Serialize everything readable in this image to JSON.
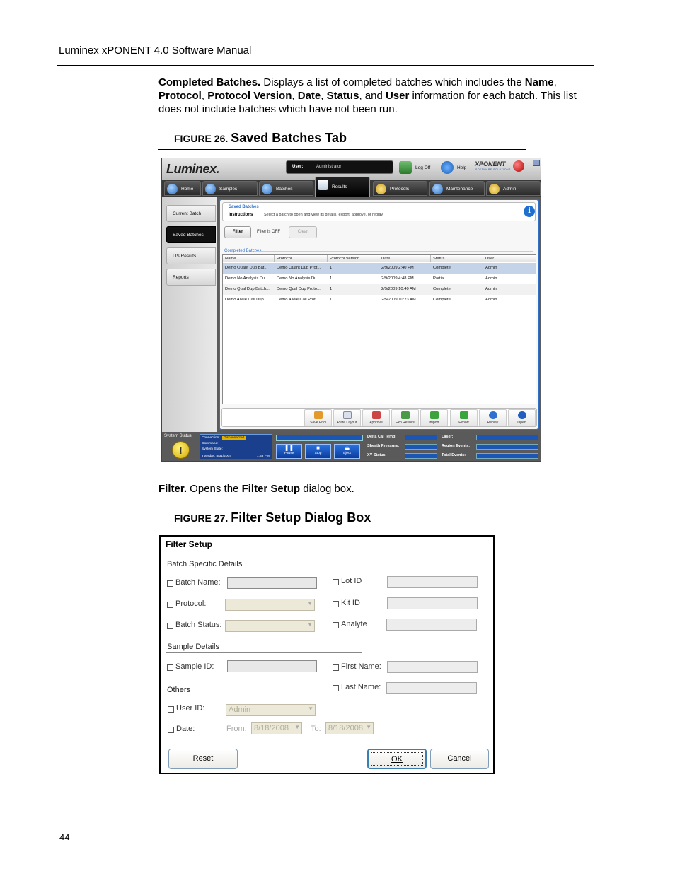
{
  "header": {
    "title": "Luminex xPONENT 4.0 Software Manual"
  },
  "para1": {
    "b1": "Completed Batches.",
    "t1": " Displays a list of completed batches which includes the ",
    "b2": "Name",
    "t2": ",",
    "b3": "Protocol",
    "t3": ", ",
    "b4": "Protocol Version",
    "t4": ", ",
    "b5": "Date",
    "t5": ", ",
    "b6": "Status",
    "t6": ", and ",
    "b7": "User",
    "t7": " information for each batch. This list",
    "line3": "does not include batches which have not been run."
  },
  "fig26": {
    "label": "FIGURE 26.",
    "title": "Saved Batches Tab"
  },
  "app": {
    "logo": "Luminex.",
    "user_label": "User:",
    "user_value": "Administrator",
    "logoff": "Log Off",
    "help": "Help",
    "brand": "XPONENT",
    "brand_sub": "SOFTWARE SOLUTIONS",
    "tabs": [
      "Home",
      "Samples",
      "Batches",
      "Results",
      "Protocols",
      "Maintenance",
      "Admin"
    ],
    "side": [
      "Current Batch",
      "Saved Batches",
      "LIS Results",
      "Reports"
    ],
    "instr_title": "Saved Batches",
    "instr_label": "Instructions",
    "instr_text": "Select a batch to open and view its details, export, approve, or replay.",
    "filter_btn": "Filter",
    "filter_status": "Filter is OFF",
    "clear_btn": "Clear",
    "completed_label": "Completed Batches",
    "columns": [
      "Name",
      "Protocol",
      "Protocol Version",
      "Date",
      "Status",
      "User"
    ],
    "rows": [
      [
        "Demo Quant Dup Bat...",
        "Demo Quant Dup Prot...",
        "1",
        "2/9/2009 2:40 PM",
        "Complete",
        "Admin"
      ],
      [
        "Demo No Analysis Du...",
        "Demo No Analysis Du...",
        "1",
        "2/9/2009 4:48 PM",
        "Partial",
        "Admin"
      ],
      [
        "Demo Qual Dup Batch...",
        "Demo Qual Dup Proto...",
        "1",
        "2/5/2009 10:40 AM",
        "Complete",
        "Admin"
      ],
      [
        "Demo Allele Call Dup ...",
        "Demo Allele Call Prot...",
        "1",
        "2/5/2009 10:23 AM",
        "Complete",
        "Admin"
      ]
    ],
    "toolbar": [
      "Save Prtcl",
      "Plate Layout",
      "Approve",
      "Exp Results",
      "Import",
      "Export",
      "Replay",
      "Open"
    ],
    "status": {
      "system_status": "System Status",
      "connection_label": "Connection:",
      "connection_value": "Disconnected",
      "command_label": "Command:",
      "state_label": "System State:",
      "date": "Tuesday, 8/31/2004",
      "time": "1:53 PM",
      "pause": "Pause",
      "stop": "Stop",
      "eject": "Eject",
      "delta_cal": "Delta Cal Temp:",
      "sheath": "Sheath Pressure:",
      "xy": "XY Status:",
      "laser": "Laser:",
      "region_events": "Region Events:",
      "total_events": "Total Events:"
    }
  },
  "para2": {
    "b1": "Filter.",
    "t1": " Opens the ",
    "b2": "Filter Setup",
    "t2": " dialog box."
  },
  "fig27": {
    "label": "FIGURE 27.",
    "title": "Filter Setup Dialog Box"
  },
  "dialog": {
    "title": "Filter Setup",
    "sec_batch": "Batch Specific Details",
    "batch_name": "Batch Name:",
    "protocol": "Protocol:",
    "batch_status": "Batch Status:",
    "lot_id": "Lot ID",
    "kit_id": "Kit ID",
    "analyte": "Analyte",
    "sec_sample": "Sample Details",
    "sample_id": "Sample ID:",
    "first_name": "First Name:",
    "last_name": "Last Name:",
    "sec_others": "Others",
    "user_id": "User ID:",
    "user_id_value": "Admin",
    "date": "Date:",
    "from": "From:",
    "from_value": "8/18/2008",
    "to": "To:",
    "to_value": "8/18/2008",
    "reset": "Reset",
    "ok": "OK",
    "cancel": "Cancel"
  },
  "footer": {
    "page": "44"
  }
}
